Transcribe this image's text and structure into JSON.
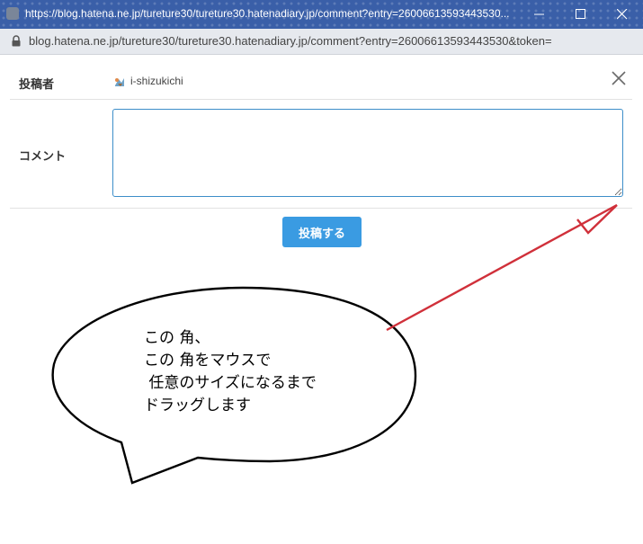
{
  "window": {
    "title": "https://blog.hatena.ne.jp/tureture30/tureture30.hatenadiary.jp/comment?entry=26006613593443530...",
    "url": "blog.hatena.ne.jp/tureture30/tureture30.hatenadiary.jp/comment?entry=26006613593443530&token="
  },
  "form": {
    "poster_label": "投稿者",
    "username": "i-shizukichi",
    "comment_label": "コメント",
    "comment_value": "",
    "submit_label": "投稿する"
  },
  "annotation": {
    "lines": [
      "この 角、",
      "この 角をマウスで",
      " 任意のサイズになるまで",
      "ドラッグします"
    ],
    "arrow_color": "#d0303a"
  },
  "colors": {
    "titlebar": "#3a5fa8",
    "accent": "#3a9be2",
    "textarea_border": "#3d8ec9"
  }
}
